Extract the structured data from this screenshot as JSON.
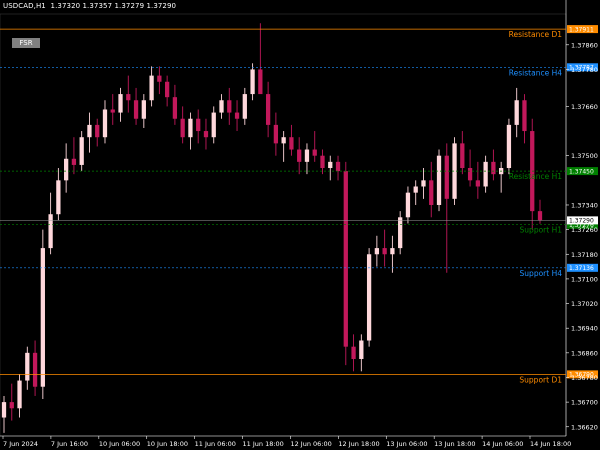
{
  "header": {
    "symbol_timeframe": "USDCAD,H1",
    "ohlc": "1.37320 1.37357 1.37279 1.37290"
  },
  "fsr_button": {
    "label": "FSR"
  },
  "colors": {
    "background": "#000000",
    "bull_candle": "#ffd8dc",
    "bear_candle": "#c2185b",
    "resistance_d1": "#ff8c00",
    "resistance_h4": "#1e90ff",
    "resistance_h1": "#008000",
    "support_h1": "#008000",
    "support_h4": "#1e90ff",
    "support_d1": "#ff8c00",
    "axis_text": "#ffffff",
    "grid_separator": "#808080"
  },
  "price_axis": {
    "min": 1.3659,
    "max": 1.3796,
    "ticks": [
      "1.37860",
      "1.37780",
      "1.37660",
      "1.37500",
      "1.37340",
      "1.37260",
      "1.37180",
      "1.37100",
      "1.37020",
      "1.36940",
      "1.36860",
      "1.36780",
      "1.36700",
      "1.36620"
    ],
    "current_price": "1.37290"
  },
  "levels": [
    {
      "name": "Resistance D1",
      "label": "Resistance D1",
      "price": "1.37911",
      "value": 1.37911,
      "style": "solid",
      "color": "#ff8c00"
    },
    {
      "name": "Resistance H4",
      "label": "Resistance H4",
      "price": "1.37787",
      "value": 1.37787,
      "style": "dotted",
      "color": "#1e90ff"
    },
    {
      "name": "Resistance H1",
      "label": "Resistance H1",
      "price": "1.37450",
      "value": 1.3745,
      "style": "dotted",
      "color": "#008000"
    },
    {
      "name": "Support H1",
      "label": "Support H1",
      "price": "1.37276",
      "value": 1.37276,
      "style": "dotted",
      "color": "#008000"
    },
    {
      "name": "Support H4",
      "label": "Support H4",
      "price": "1.37136",
      "value": 1.37136,
      "style": "dotted",
      "color": "#1e90ff"
    },
    {
      "name": "Support D1",
      "label": "Support D1",
      "price": "1.36790",
      "value": 1.3679,
      "style": "solid",
      "color": "#ff8c00"
    }
  ],
  "time_axis": {
    "labels": [
      "7 Jun 2024",
      "7 Jun 16:00",
      "10 Jun 06:00",
      "10 Jun 18:00",
      "11 Jun 06:00",
      "11 Jun 18:00",
      "12 Jun 06:00",
      "12 Jun 18:00",
      "13 Jun 06:00",
      "13 Jun 18:00",
      "14 Jun 06:00",
      "14 Jun 18:00"
    ]
  },
  "chart_data": {
    "type": "candlestick",
    "series": [
      {
        "values": [
          [
            1.3665,
            1.3672,
            1.366,
            1.367
          ],
          [
            1.367,
            1.3676,
            1.3664,
            1.3668
          ],
          [
            1.3668,
            1.3679,
            1.3665,
            1.3677
          ],
          [
            1.3677,
            1.3688,
            1.3674,
            1.3686
          ],
          [
            1.3686,
            1.369,
            1.3672,
            1.3675
          ],
          [
            1.3675,
            1.3726,
            1.3671,
            1.372
          ],
          [
            1.372,
            1.3738,
            1.3718,
            1.3731
          ],
          [
            1.3731,
            1.3746,
            1.3729,
            1.3742
          ],
          [
            1.3742,
            1.3754,
            1.3738,
            1.3749
          ],
          [
            1.3749,
            1.3756,
            1.3744,
            1.3747
          ],
          [
            1.3747,
            1.3758,
            1.3745,
            1.3756
          ],
          [
            1.3756,
            1.3764,
            1.3751,
            1.376
          ],
          [
            1.376,
            1.3762,
            1.3753,
            1.3756
          ],
          [
            1.3756,
            1.3768,
            1.3754,
            1.3765
          ],
          [
            1.3765,
            1.377,
            1.376,
            1.3764
          ],
          [
            1.3764,
            1.3772,
            1.3761,
            1.377
          ],
          [
            1.377,
            1.3776,
            1.3764,
            1.3768
          ],
          [
            1.3768,
            1.3772,
            1.376,
            1.3762
          ],
          [
            1.3762,
            1.377,
            1.3759,
            1.3768
          ],
          [
            1.3768,
            1.3779,
            1.3766,
            1.3776
          ],
          [
            1.3776,
            1.3779,
            1.377,
            1.3774
          ],
          [
            1.3774,
            1.3776,
            1.3766,
            1.3769
          ],
          [
            1.3769,
            1.3773,
            1.376,
            1.3762
          ],
          [
            1.3762,
            1.3766,
            1.3754,
            1.3756
          ],
          [
            1.3756,
            1.3764,
            1.3752,
            1.3762
          ],
          [
            1.3762,
            1.3765,
            1.3754,
            1.3758
          ],
          [
            1.3758,
            1.3762,
            1.3752,
            1.3756
          ],
          [
            1.3756,
            1.3766,
            1.3754,
            1.3764
          ],
          [
            1.3764,
            1.377,
            1.3762,
            1.3768
          ],
          [
            1.3768,
            1.3772,
            1.376,
            1.3764
          ],
          [
            1.3764,
            1.3768,
            1.3758,
            1.3762
          ],
          [
            1.3762,
            1.3772,
            1.376,
            1.377
          ],
          [
            1.377,
            1.378,
            1.3768,
            1.3778
          ],
          [
            1.3778,
            1.3793,
            1.3774,
            1.377
          ],
          [
            1.377,
            1.3774,
            1.3756,
            1.376
          ],
          [
            1.376,
            1.3764,
            1.375,
            1.3754
          ],
          [
            1.3754,
            1.3758,
            1.3748,
            1.3756
          ],
          [
            1.3756,
            1.376,
            1.375,
            1.3752
          ],
          [
            1.3752,
            1.3756,
            1.3744,
            1.3748
          ],
          [
            1.3748,
            1.3754,
            1.3744,
            1.3752
          ],
          [
            1.3752,
            1.3758,
            1.3748,
            1.375
          ],
          [
            1.375,
            1.3752,
            1.3744,
            1.3746
          ],
          [
            1.3746,
            1.375,
            1.3742,
            1.3748
          ],
          [
            1.3748,
            1.375,
            1.3742,
            1.3745
          ],
          [
            1.3745,
            1.3748,
            1.3682,
            1.3688
          ],
          [
            1.3688,
            1.3692,
            1.368,
            1.3684
          ],
          [
            1.3684,
            1.3692,
            1.368,
            1.369
          ],
          [
            1.369,
            1.372,
            1.3688,
            1.3718
          ],
          [
            1.3718,
            1.3724,
            1.3714,
            1.372
          ],
          [
            1.372,
            1.3726,
            1.3714,
            1.3718
          ],
          [
            1.3718,
            1.3724,
            1.3712,
            1.372
          ],
          [
            1.372,
            1.3732,
            1.3718,
            1.373
          ],
          [
            1.373,
            1.374,
            1.3728,
            1.3738
          ],
          [
            1.3738,
            1.3742,
            1.3734,
            1.374
          ],
          [
            1.374,
            1.3746,
            1.3736,
            1.3742
          ],
          [
            1.3742,
            1.3748,
            1.373,
            1.3734
          ],
          [
            1.3734,
            1.3752,
            1.3732,
            1.375
          ],
          [
            1.375,
            1.3754,
            1.3712,
            1.3736
          ],
          [
            1.3736,
            1.3756,
            1.3734,
            1.3754
          ],
          [
            1.3754,
            1.3758,
            1.3744,
            1.3746
          ],
          [
            1.3746,
            1.3752,
            1.374,
            1.3742
          ],
          [
            1.3742,
            1.3748,
            1.3736,
            1.374
          ],
          [
            1.374,
            1.375,
            1.3738,
            1.3748
          ],
          [
            1.3748,
            1.3752,
            1.3742,
            1.3744
          ],
          [
            1.3744,
            1.3748,
            1.3738,
            1.3746
          ],
          [
            1.3746,
            1.3762,
            1.3744,
            1.376
          ],
          [
            1.376,
            1.3772,
            1.3756,
            1.3768
          ],
          [
            1.3768,
            1.377,
            1.3754,
            1.3758
          ],
          [
            1.3758,
            1.3762,
            1.3726,
            1.3732
          ],
          [
            1.3732,
            1.37357,
            1.37279,
            1.3729
          ]
        ]
      }
    ],
    "xlabel": "",
    "ylabel": ""
  }
}
